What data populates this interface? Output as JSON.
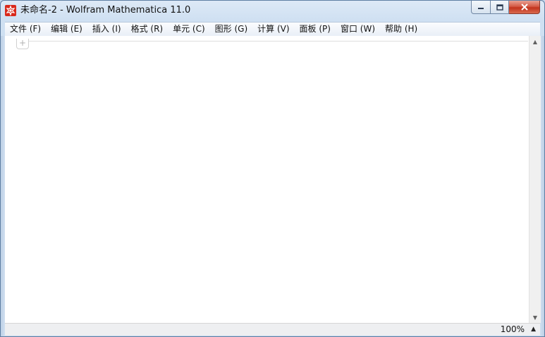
{
  "window": {
    "title": "未命名-2 - Wolfram Mathematica 11.0",
    "app_icon": "mathematica-spikey-icon",
    "accent_color": "#d92a1c"
  },
  "caption_buttons": {
    "minimize": "minimize-icon",
    "maximize": "maximize-icon",
    "close": "close-icon"
  },
  "menu": {
    "items": [
      {
        "label": "文件 (F)"
      },
      {
        "label": "编辑 (E)"
      },
      {
        "label": "插入 (I)"
      },
      {
        "label": "格式 (R)"
      },
      {
        "label": "单元 (C)"
      },
      {
        "label": "图形 (G)"
      },
      {
        "label": "计算 (V)"
      },
      {
        "label": "面板 (P)"
      },
      {
        "label": "窗口 (W)"
      },
      {
        "label": "帮助 (H)"
      }
    ]
  },
  "notebook": {
    "cell_insertion_glyph": "+"
  },
  "status": {
    "zoom": "100%",
    "zoom_menu_glyph": "▲"
  }
}
